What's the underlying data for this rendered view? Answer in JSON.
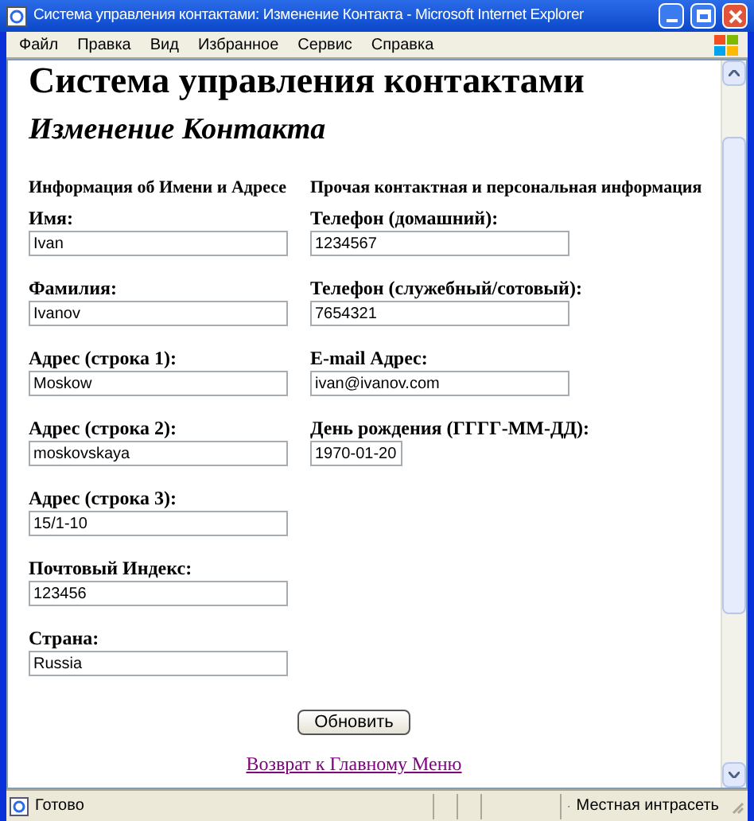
{
  "window": {
    "title": "Система управления контактами: Изменение Контакта - Microsoft Internet Explorer"
  },
  "menu": [
    "Файл",
    "Правка",
    "Вид",
    "Избранное",
    "Сервис",
    "Справка"
  ],
  "page": {
    "heading": "Система управления контактами",
    "subheading": "Изменение Контакта",
    "columns": [
      {
        "header": "Информация об Имени и Адресе",
        "fields": [
          {
            "label": "Имя:",
            "value": "Ivan",
            "kind": "text"
          },
          {
            "label": "Фамилия:",
            "value": "Ivanov",
            "kind": "text"
          },
          {
            "label": "Адрес (строка 1):",
            "value": "Moskow",
            "kind": "text"
          },
          {
            "label": "Адрес (строка 2):",
            "value": "moskovskaya",
            "kind": "text"
          },
          {
            "label": "Адрес (строка 3):",
            "value": "15/1-10",
            "kind": "text"
          },
          {
            "label": "Почтовый Индекс:",
            "value": "123456",
            "kind": "text"
          },
          {
            "label": "Страна:",
            "value": "Russia",
            "kind": "text"
          }
        ]
      },
      {
        "header": "Прочая контактная и персональная информация",
        "fields": [
          {
            "label": "Телефон (домашний):",
            "value": "1234567",
            "kind": "text"
          },
          {
            "label": "Телефон (служебный/сотовый):",
            "value": "7654321",
            "kind": "text"
          },
          {
            "label": "E-mail Адрес:",
            "value": "ivan@ivanov.com",
            "kind": "text"
          },
          {
            "label": "День рождения (ГГГГ-ММ-ДД):",
            "value": "1970-01-20",
            "kind": "date"
          }
        ]
      }
    ],
    "button": "Обновить",
    "link": "Возврат к Главному Меню"
  },
  "status_bar": {
    "status": "Готово",
    "zone": "Местная интрасеть"
  }
}
